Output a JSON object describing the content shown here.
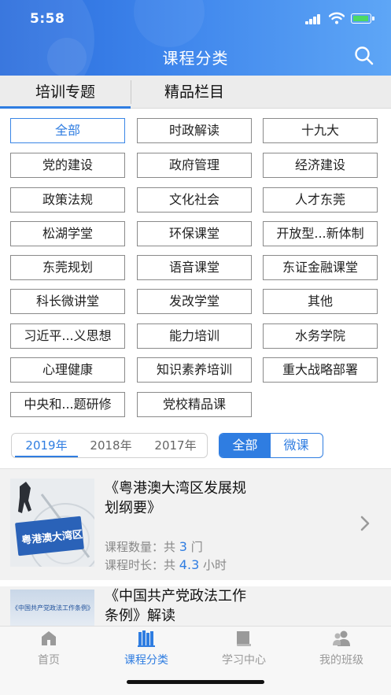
{
  "status_bar": {
    "time": "5:58"
  },
  "header": {
    "title": "课程分类"
  },
  "tabs": [
    {
      "label": "培训专题",
      "active": true
    },
    {
      "label": "精品栏目",
      "active": false
    }
  ],
  "categories": [
    "全部",
    "时政解读",
    "十九大",
    "党的建设",
    "政府管理",
    "经济建设",
    "政策法规",
    "文化社会",
    "人才东莞",
    "松湖学堂",
    "环保课堂",
    "开放型...新体制",
    "东莞规划",
    "语音课堂",
    "东证金融课堂",
    "科长微讲堂",
    "发改学堂",
    "其他",
    "习近平...义思想",
    "能力培训",
    "水务学院",
    "心理健康",
    "知识素养培训",
    "重大战略部署",
    "中央和...题研修",
    "党校精品课"
  ],
  "selected_category": "全部",
  "years": [
    "2019年",
    "2018年",
    "2017年"
  ],
  "selected_year": "2019年",
  "course_types": [
    "全部",
    "微课"
  ],
  "selected_type": "全部",
  "courses": [
    {
      "title_line1": "《粤港澳大湾区发展规",
      "title_line2": "划纲要》",
      "count_label": "课程数量：共",
      "count": "3",
      "count_unit": "门",
      "duration_label": "课程时长：共",
      "duration": "4.3",
      "duration_unit": "小时",
      "thumb_text": "粤港澳大湾区"
    },
    {
      "title_line1": "《中国共产党政法工作",
      "title_line2": "条例》解读",
      "thumb_text": "《中国共产党政法工作条例》解读"
    }
  ],
  "bottom_nav": [
    {
      "label": "首页",
      "icon": "home-icon"
    },
    {
      "label": "课程分类",
      "icon": "books-icon",
      "active": true
    },
    {
      "label": "学习中心",
      "icon": "book-icon"
    },
    {
      "label": "我的班级",
      "icon": "people-icon"
    }
  ],
  "colors": {
    "accent": "#2f7de1",
    "header_start": "#2a6cdc",
    "header_end": "#5ea6f6"
  }
}
